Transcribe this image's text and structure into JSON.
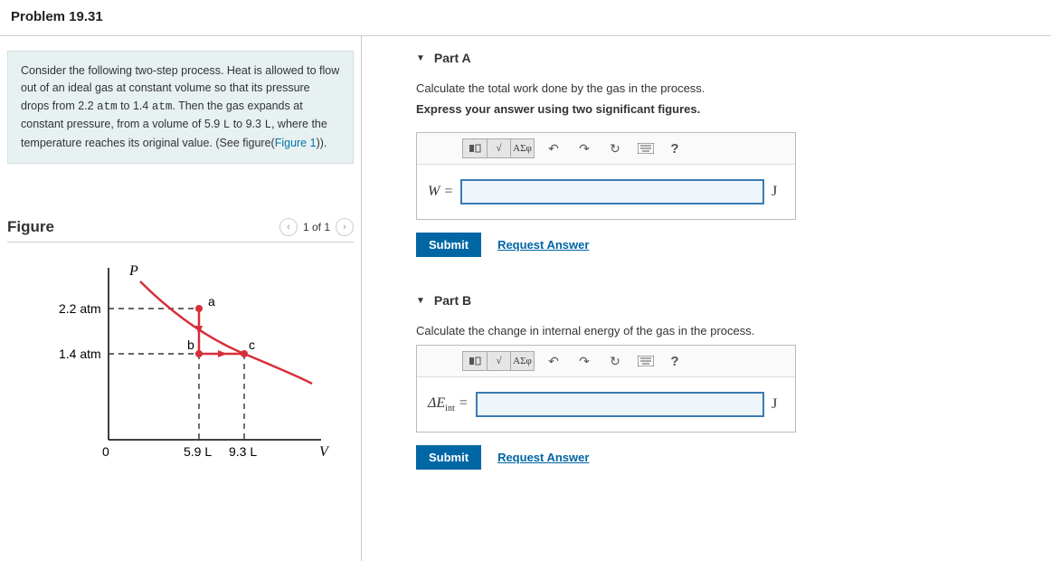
{
  "header": {
    "title": "Problem 19.31"
  },
  "problem": {
    "text_parts": [
      "Consider the following two-step process. Heat is allowed to flow out of an ideal gas at constant volume so that its pressure drops from 2.2 ",
      "atm",
      " to 1.4 ",
      "atm",
      ". Then the gas expands at constant pressure, from a volume of 5.9 ",
      "L",
      " to 9.3 ",
      "L",
      ", where the temperature reaches its original value. (See figure("
    ],
    "figure_link": "Figure 1",
    "text_end": "))."
  },
  "figure": {
    "title": "Figure",
    "counter": "1 of 1",
    "axes": {
      "y_label": "P",
      "x_label": "V",
      "y_ticks": [
        "2.2 atm",
        "1.4 atm"
      ],
      "x_ticks": [
        "5.9 L",
        "9.3 L"
      ],
      "origin": "0"
    },
    "points": [
      "a",
      "b",
      "c"
    ]
  },
  "parts": [
    {
      "title": "Part A",
      "prompt": "Calculate the total work done by the gas in the process.",
      "instruction": "Express your answer using two significant figures.",
      "var_html": "W =",
      "unit": "J",
      "submit": "Submit",
      "request": "Request Answer",
      "toolbar_greek": "ΑΣφ"
    },
    {
      "title": "Part B",
      "prompt": "Calculate the change in internal energy of the gas in the process.",
      "instruction": "",
      "var_html": "ΔEint =",
      "unit": "J",
      "submit": "Submit",
      "request": "Request Answer",
      "toolbar_greek": "ΑΣφ"
    }
  ]
}
